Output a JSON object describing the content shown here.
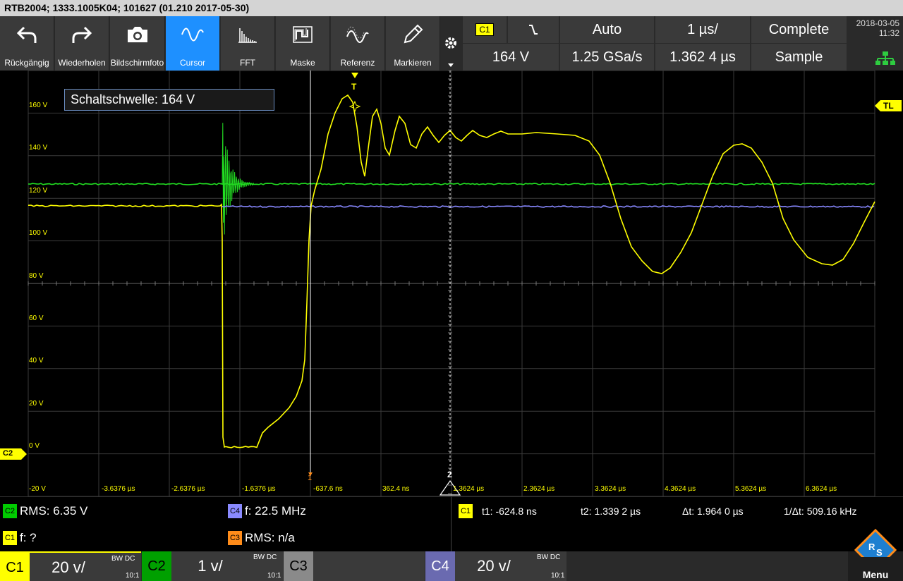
{
  "title": "RTB2004; 1333.1005K04; 101627 (01.210 2017-05-30)",
  "toolbar": {
    "buttons": [
      {
        "label": "Rückgängig",
        "icon": "undo-icon"
      },
      {
        "label": "Wiederholen",
        "icon": "redo-icon"
      },
      {
        "label": "Bildschirmfoto",
        "icon": "camera-icon"
      },
      {
        "label": "Cursor",
        "icon": "sine-wave-icon",
        "active": true
      },
      {
        "label": "FFT",
        "icon": "fft-icon"
      },
      {
        "label": "Maske",
        "icon": "mask-icon"
      },
      {
        "label": "Referenz",
        "icon": "reference-icon"
      },
      {
        "label": "Markieren",
        "icon": "pen-icon"
      }
    ]
  },
  "trigger": {
    "channel": "C1",
    "edge_symbol": "⧹",
    "mode": "Auto",
    "level": "164 V",
    "timebase": "1 µs/",
    "sample_rate": "1.25 GSa/s",
    "position": "1.362 4 µs",
    "acq_status": "Complete",
    "acq_mode": "Sample"
  },
  "datetime": {
    "date": "2018-03-05",
    "time": "11:32"
  },
  "plot": {
    "y_labels": [
      "160 V",
      "140 V",
      "120 V",
      "100 V",
      "80 V",
      "60 V",
      "40 V",
      "20 V",
      "0 V",
      "-20 V"
    ],
    "x_labels": [
      "-3.6376 µs",
      "-2.6376 µs",
      "-1.6376 µs",
      "-637.6 ns",
      "362.4 ns",
      "1.3624 µs",
      "2.3624 µs",
      "3.3624 µs",
      "4.3624 µs",
      "5.3624 µs",
      "6.3624 µs"
    ],
    "popup": "Schaltschwelle: 164 V",
    "tl_label": "TL",
    "trigger_marker": "T",
    "c2_marker": "C2",
    "cursor1_marker": "1",
    "cursor2_marker": "2"
  },
  "measurements": {
    "c2_rms": {
      "chip": "C2",
      "text": "RMS: 6.35 V",
      "color": "#00cc00"
    },
    "c4_freq": {
      "chip": "C4",
      "text": "f: 22.5 MHz",
      "color": "#8a8aff"
    },
    "c1_freq": {
      "chip": "C1",
      "text": "f: ?",
      "color": "#ffff00"
    },
    "c3_rms": {
      "chip": "C3",
      "text": "RMS: n/a",
      "color": "#ff8c1a"
    },
    "cursor": {
      "chip": "C1",
      "t1": "t1: -624.8 ns",
      "t2": "t2: 1.339 2 µs",
      "dt": "Δt: 1.964 0 µs",
      "inv_dt": "1/Δt: 509.16 kHz"
    }
  },
  "channels": [
    {
      "tag": "C1",
      "value": "20 v/",
      "bw": "BW DC",
      "probe": "10:1",
      "color": "#ffff00",
      "text_color": "#000"
    },
    {
      "tag": "C2",
      "value": "1 v/",
      "bw": "BW DC",
      "probe": "10:1",
      "color": "#00a000",
      "text_color": "#000"
    },
    {
      "tag": "C3",
      "value": "",
      "bw": "",
      "probe": "",
      "color": "#8a8a8a",
      "text_color": "#000"
    },
    {
      "tag": "C4",
      "value": "20 v/",
      "bw": "BW DC",
      "probe": "10:1",
      "color": "#6a6ab0",
      "text_color": "#fff"
    }
  ],
  "menu_label": "Menu",
  "colors": {
    "yellow": "#ffff00",
    "green": "#22dd22",
    "purple": "#8888ff",
    "accent": "#1e90ff"
  }
}
